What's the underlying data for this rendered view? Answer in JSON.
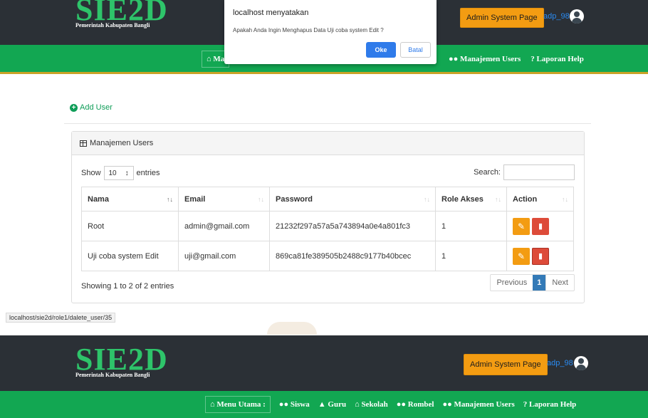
{
  "header": {
    "logo_text": "SIE2D",
    "logo_subtitle": "Pemerintah Kabupaten Bangli",
    "admin_button": "Admin System Page",
    "username": "adp_98"
  },
  "nav": {
    "menu_label": "Menu Utama :",
    "menu_label_partial": "Ma",
    "items": [
      "Siswa",
      "Guru",
      "Sekolah",
      "Rombel",
      "Manajemen Users",
      "Laporan Help"
    ],
    "visible_top": [
      "Manajemen Users",
      "Laporan Help"
    ],
    "icons": [
      "home-icon",
      "users-icon",
      "graduation-cap-icon",
      "bank-icon",
      "group-icon",
      "group-icon",
      "question-icon"
    ]
  },
  "dialog": {
    "title": "localhost menyatakan",
    "message": "Apakah Anda Ingin Menghapus Data Uji coba system Edit ?",
    "ok_label": "Oke",
    "cancel_label": "Batal"
  },
  "add_user_label": "Add User",
  "panel": {
    "title": "Manajemen Users",
    "show_label": "Show",
    "entries_value": "10",
    "entries_label": "entries",
    "search_label": "Search:",
    "columns": [
      "Nama",
      "Email",
      "Password",
      "Role Akses",
      "Action"
    ],
    "rows": [
      {
        "nama": "Root",
        "email": "admin@gmail.com",
        "password": "21232f297a57a5a743894a0e4a801fc3",
        "role": "1"
      },
      {
        "nama": "Uji coba system Edit",
        "email": "uji@gmail.com",
        "password": "869ca81fe389505b2488c9177b40bcec",
        "role": "1"
      }
    ],
    "info": "Showing 1 to 2 of 2 entries",
    "pagination": {
      "previous": "Previous",
      "current": "1",
      "next": "Next"
    }
  },
  "status_url": "localhost/sie2d/role1/dalete_user/35",
  "colors": {
    "nav_green": "#12a752",
    "header_dark": "#2b3036",
    "accent_orange": "#f39c12",
    "danger_red": "#dd4b39",
    "link_green": "#0f9d58"
  }
}
